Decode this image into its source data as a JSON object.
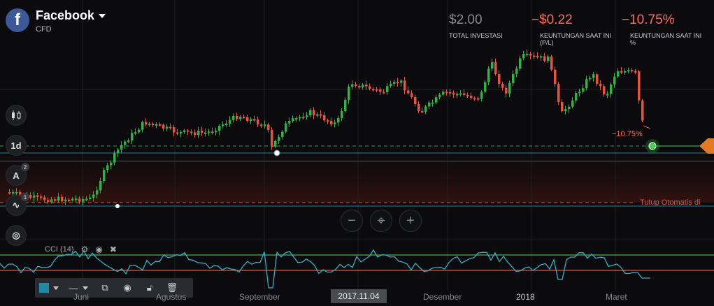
{
  "asset": {
    "name": "Facebook",
    "type": "CFD",
    "logo_letter": "f",
    "logo_color": "#3b5998"
  },
  "stats": [
    {
      "value": "$2.00",
      "label": "TOTAL INVESTASI",
      "color": "#8a8a8a"
    },
    {
      "value": "−$0.22",
      "label": "KEUNTUNGAN SAAT INI (P/L)",
      "color": "#ff6b5a"
    },
    {
      "value": "−10.75%",
      "label": "KEUNTUNGAN SAAT INI %",
      "color": "#ff6b5a"
    }
  ],
  "toolbar": [
    {
      "icon": "candlestick-icon",
      "glyph": "▮▯",
      "badge": ""
    },
    {
      "icon": "timeframe-icon",
      "glyph": "1d",
      "badge": ""
    },
    {
      "icon": "drawing-tools-icon",
      "glyph": "A",
      "badge": "2"
    },
    {
      "icon": "indicators-icon",
      "glyph": "∿",
      "badge": "1"
    },
    {
      "icon": "settings-icon",
      "glyph": "◎",
      "badge": ""
    }
  ],
  "position_label": "−10.75%",
  "auto_close_label": "Tutup Otomatis di",
  "indicator": {
    "label": "CCI (14)"
  },
  "x_axis": {
    "labels": [
      "Juni",
      "Agustus",
      "September",
      "Desember",
      "2018",
      "Maret"
    ],
    "active_date": "2017.11.04"
  },
  "colors": {
    "up": "#2fb344",
    "down": "#e8533e",
    "cci_line": "#2ab3c9",
    "upper_band": "#4caf50",
    "lower_band": "#e8533e",
    "entry_line": "#3a9a5a",
    "blue_lines": "#2e7f9a"
  },
  "zoom_controls": [
    {
      "name": "zoom-out-button",
      "glyph": "−"
    },
    {
      "name": "center-button",
      "glyph": "⌖"
    },
    {
      "name": "zoom-in-button",
      "glyph": "+"
    }
  ],
  "draw_toolbar": {
    "color": "#1e8aa8"
  }
}
